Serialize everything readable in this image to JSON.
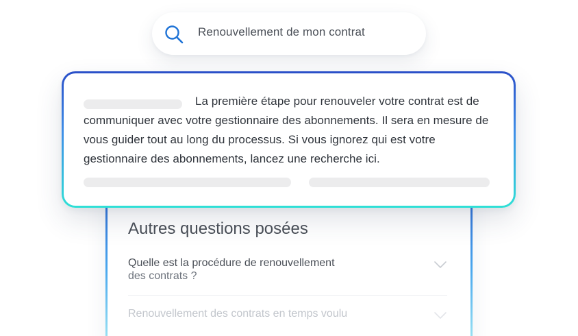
{
  "search": {
    "query": "Renouvellement de mon contrat",
    "icon": "search-icon",
    "icon_color": "#1f73d6"
  },
  "answer": {
    "text": "La première étape pour renouveler votre contrat est de communiquer avec votre gestionnaire des abonnements. Il sera en mesure de vous guider tout au long du processus. Si vous ignorez qui est votre gestionnaire des abonnements, lancez une recherche ici.",
    "border_gradient": [
      "#2a4fc8",
      "#3f8fe8",
      "#2fe0d6"
    ]
  },
  "faq": {
    "title": "Autres questions posées",
    "items": [
      {
        "line1": "Quelle est la procédure de renouvellement",
        "line2": "des contrats ?",
        "icon": "chevron-down-icon"
      },
      {
        "line1": "Renouvellement des contrats en temps voulu",
        "icon": "chevron-down-icon"
      }
    ]
  },
  "colors": {
    "text_primary": "#2f343b",
    "text_secondary": "#4a4f57",
    "placeholder": "#ececed",
    "accent_blue": "#2a4fc8",
    "accent_teal": "#2fe0d6"
  }
}
